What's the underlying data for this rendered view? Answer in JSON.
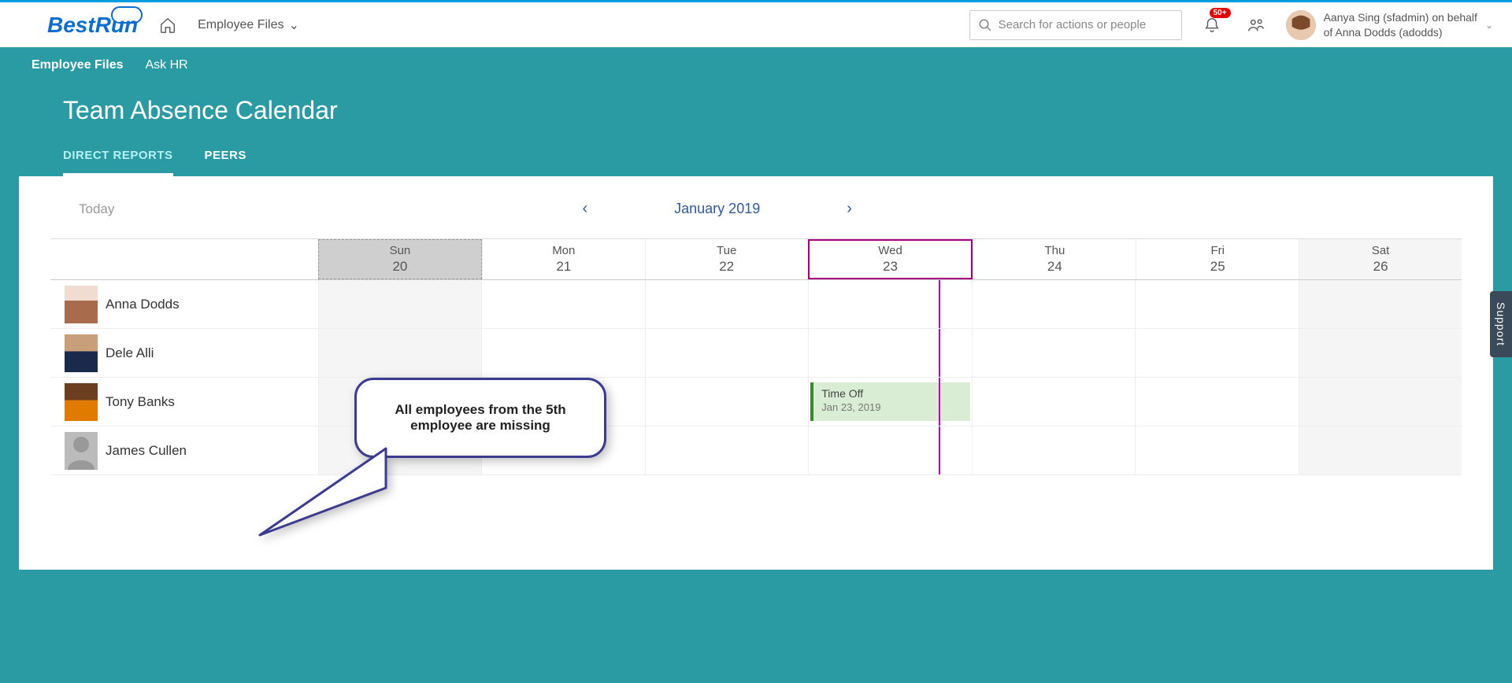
{
  "brand": "BestRun",
  "nav": {
    "dropdown_label": "Employee Files"
  },
  "search": {
    "placeholder": "Search for actions or people"
  },
  "notifications": {
    "badge": "50+"
  },
  "user": {
    "line1": "Aanya Sing (sfadmin) on behalf",
    "line2": "of Anna Dodds (adodds)"
  },
  "subnav": {
    "item1": "Employee Files",
    "item2": "Ask HR"
  },
  "page_title": "Team Absence Calendar",
  "tabs": {
    "tab1": "DIRECT REPORTS",
    "tab2": "PEERS"
  },
  "calendar": {
    "today_label": "Today",
    "month_label": "January 2019",
    "days": [
      {
        "dow": "Sun",
        "num": "20"
      },
      {
        "dow": "Mon",
        "num": "21"
      },
      {
        "dow": "Tue",
        "num": "22"
      },
      {
        "dow": "Wed",
        "num": "23"
      },
      {
        "dow": "Thu",
        "num": "24"
      },
      {
        "dow": "Fri",
        "num": "25"
      },
      {
        "dow": "Sat",
        "num": "26"
      }
    ],
    "employees": [
      {
        "name": "Anna Dodds"
      },
      {
        "name": "Dele Alli"
      },
      {
        "name": "Tony Banks"
      },
      {
        "name": "James Cullen"
      }
    ],
    "event": {
      "title": "Time Off",
      "date": "Jan 23, 2019"
    }
  },
  "callout": {
    "text": "All employees from the 5th employee are missing"
  },
  "support_label": "Support"
}
